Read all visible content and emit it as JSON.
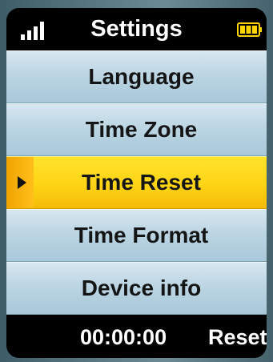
{
  "header": {
    "title": "Settings",
    "signal_icon": "signal-bars-icon",
    "battery_icon": "battery-icon",
    "battery_color": "#ffd400"
  },
  "menu": {
    "items": [
      {
        "label": "Language",
        "selected": false
      },
      {
        "label": "Time Zone",
        "selected": false
      },
      {
        "label": "Time Reset",
        "selected": true
      },
      {
        "label": "Time Format",
        "selected": false
      },
      {
        "label": "Device info",
        "selected": false
      }
    ],
    "pointer_icon": "triangle-right-icon",
    "selected_color": "#ffd415",
    "item_color": "#bad4e2"
  },
  "footer": {
    "time": "00:00:00",
    "action": "Reset"
  }
}
